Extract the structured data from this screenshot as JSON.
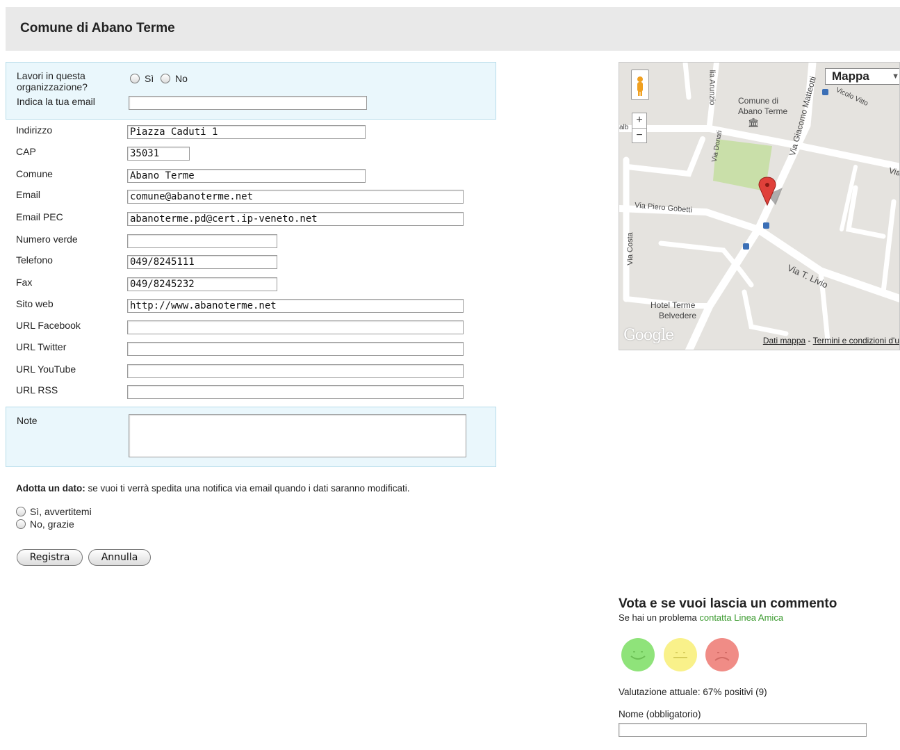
{
  "page_title": "Comune di Abano Terme",
  "org_box": {
    "work_question": "Lavori in questa organizzazione?",
    "yes_label": "Sì",
    "no_label": "No",
    "email_label": "Indica la tua email",
    "email_value": ""
  },
  "fields": {
    "indirizzo": {
      "label": "Indirizzo",
      "value": "Piazza Caduti 1"
    },
    "cap": {
      "label": "CAP",
      "value": "35031"
    },
    "comune": {
      "label": "Comune",
      "value": "Abano Terme"
    },
    "email": {
      "label": "Email",
      "value": "comune@abanoterme.net"
    },
    "email_pec": {
      "label": "Email PEC",
      "value": "abanoterme.pd@cert.ip-veneto.net"
    },
    "numero_verde": {
      "label": "Numero verde",
      "value": ""
    },
    "telefono": {
      "label": "Telefono",
      "value": "049/8245111"
    },
    "fax": {
      "label": "Fax",
      "value": "049/8245232"
    },
    "sito_web": {
      "label": "Sito web",
      "value": "http://www.abanoterme.net"
    },
    "url_facebook": {
      "label": "URL Facebook",
      "value": ""
    },
    "url_twitter": {
      "label": "URL Twitter",
      "value": ""
    },
    "url_youtube": {
      "label": "URL YouTube",
      "value": ""
    },
    "url_rss": {
      "label": "URL RSS",
      "value": ""
    }
  },
  "note": {
    "label": "Note",
    "value": ""
  },
  "adopt": {
    "bold": "Adotta un dato:",
    "text": " se vuoi ti verrà spedita una notifica via email quando i dati saranno modificati.",
    "option_yes": "Sì, avvertitemi",
    "option_no": "No, grazie"
  },
  "buttons": {
    "register": "Registra",
    "cancel": "Annulla"
  },
  "map": {
    "type_selector": "Mappa",
    "labels": {
      "comune": "Comune di",
      "comune2": "Abano Terme",
      "via_piero_gobetti": "Via Piero Gobetti",
      "via_costa": "Via Costa",
      "via_t_livio": "Via T. Livio",
      "via_giacomo_matteotti": "Via Giacomo Matteotti",
      "via_donati": "Via Donati",
      "via_arunzio": "lia Arunzio",
      "vicolo": "Vicolo Vitto",
      "hotel": "Hotel Terme",
      "hotel2": "Belvedere",
      "via_right": "Via",
      "alb": "alb"
    },
    "google_logo": "Google",
    "footer_data": "Dati mappa",
    "footer_sep": " - ",
    "footer_terms": "Termini e condizioni d'u"
  },
  "vote": {
    "title": "Vota e se vuoi lascia un commento",
    "subtitle": "Se hai un problema ",
    "link": "contatta Linea Amica",
    "rating": "Valutazione attuale: 67% positivi (9)",
    "name_label": "Nome (obbligatorio)",
    "name_value": ""
  },
  "colors": {
    "box_bg": "#eaf7fc",
    "happy": "#8fe37a",
    "neutral": "#f9f18a",
    "sad": "#f08c86",
    "link": "#3a9a2e"
  }
}
